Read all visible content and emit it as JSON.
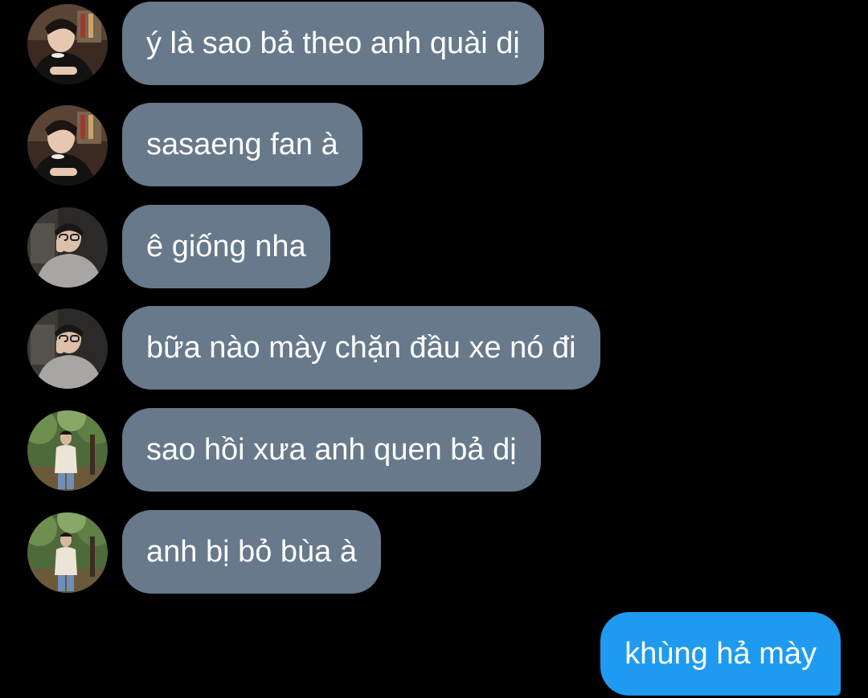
{
  "messages": [
    {
      "text": "ý là sao bả theo anh quài dị",
      "avatar_icon": "profile-photo-dark-suit"
    },
    {
      "text": "sasaeng fan à",
      "avatar_icon": "profile-photo-dark-suit"
    },
    {
      "text": "ê giống nha",
      "avatar_icon": "profile-photo-glasses-grey-hoodie"
    },
    {
      "text": "bữa nào mày chặn đầu xe nó đi",
      "avatar_icon": "profile-photo-glasses-grey-hoodie"
    },
    {
      "text": "sao hồi xưa anh quen bả dị",
      "avatar_icon": "profile-photo-outdoor-park"
    },
    {
      "text": "anh bị bỏ bùa à",
      "avatar_icon": "profile-photo-outdoor-park"
    }
  ],
  "outgoing": [
    {
      "text": "khùng hả mày"
    }
  ],
  "colors": {
    "background": "#000000",
    "incoming_bubble": "#67798b",
    "outgoing_bubble": "#1e9bf0",
    "bubble_text": "#ffffff"
  }
}
